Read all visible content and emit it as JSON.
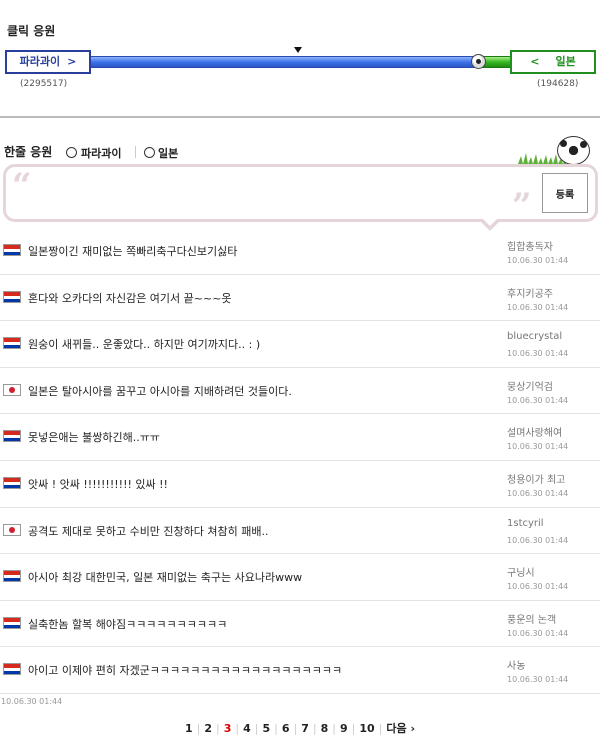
{
  "header": {
    "title": "클릭 응원"
  },
  "match": {
    "left_team": "파라과이",
    "right_team": "일본",
    "left_count": "(2295517)",
    "right_count": "(194628)",
    "left_share": 0.922
  },
  "cheer": {
    "title": "한줄 응원",
    "options": [
      "파라과이",
      "일본"
    ],
    "submit_label": "등록",
    "input_value": ""
  },
  "comments": [
    {
      "flag": "paraguay",
      "text": "일본짱이긴 재미없는 쪽빠리축구다신보기싫타",
      "author": "힙합총독자",
      "date": "10.06.30 01:44"
    },
    {
      "flag": "paraguay",
      "text": "혼다와 오카다의 자신감은 여기서 끝~~~옷",
      "author": "후지키공주",
      "date": "10.06.30 01:44"
    },
    {
      "flag": "paraguay",
      "text": "원숭이 새뀌들.. 운좋았다.. 하지만 여기까지다.. : )",
      "author": "bluecrystal",
      "date": "10.06.30 01:44"
    },
    {
      "flag": "japan",
      "text": "일본은 탈아시아를 꿈꾸고 아시아를 지배하려던 것들이다.",
      "author": "뭉상기억검",
      "date": "10.06.30 01:44"
    },
    {
      "flag": "paraguay",
      "text": "못넣은애는 불쌍하긴해..ㅠㅠ",
      "author": "설며사랑해여",
      "date": "10.06.30 01:44"
    },
    {
      "flag": "paraguay",
      "text": "앗싸 ! 앗싸 !!!!!!!!!!! 있싸 !!",
      "author": "청용이가 최고",
      "date": "10.06.30 01:44"
    },
    {
      "flag": "japan",
      "text": "공격도 제대로 못하고 수비만 진창하다 쳐참히 패배..",
      "author": "1stcyril",
      "date": "10.06.30 01:44"
    },
    {
      "flag": "paraguay",
      "text": "아시아 최강 대한민국, 일본 재미없는 축구는 사요나라www",
      "author": "구닝시",
      "date": "10.06.30 01:44"
    },
    {
      "flag": "paraguay",
      "text": "실축한놈 할복 해야짐ㅋㅋㅋㅋㅋㅋㅋㅋㅋㅋ",
      "author": "풍운의 논객",
      "date": "10.06.30 01:44"
    },
    {
      "flag": "paraguay",
      "text": "아이고 이제야 편히 자겠군ㅋㅋㅋㅋㅋㅋㅋㅋㅋㅋㅋㅋㅋㅋㅋㅋㅋㅋㅋ",
      "author": "사농",
      "date": "10.06.30 01:44"
    }
  ],
  "stray_date": "10.06.30 01:44",
  "pagination": {
    "pages": [
      "1",
      "2",
      "3",
      "4",
      "5",
      "6",
      "7",
      "8",
      "9",
      "10"
    ],
    "current": "3",
    "next_label": "다음 ›"
  }
}
